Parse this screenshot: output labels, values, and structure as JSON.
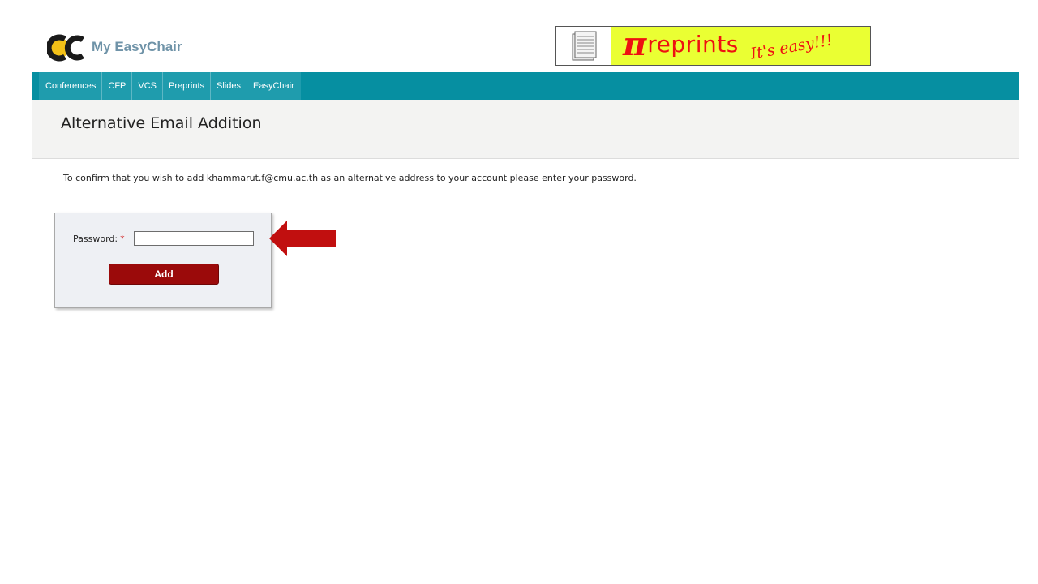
{
  "header": {
    "logo_text": "My EasyChair",
    "banner": {
      "pi_symbol": "π",
      "word": "reprints",
      "tagline": "It's easy!!!"
    }
  },
  "nav": {
    "items": [
      "Conferences",
      "CFP",
      "VCS",
      "Preprints",
      "Slides",
      "EasyChair"
    ]
  },
  "page": {
    "title": "Alternative Email Addition",
    "message": "To confirm that you wish to add khammarut.f@cmu.ac.th as an alternative address to your account please enter your password."
  },
  "form": {
    "password_label": "Password:",
    "required_marker": "*",
    "password_value": "",
    "submit_label": "Add"
  },
  "colors": {
    "nav_bg": "#068fa1",
    "button_bg": "#9b0a0a",
    "arrow": "#c10f0f",
    "banner_bg": "#eaff33",
    "banner_text": "#ee1111"
  }
}
